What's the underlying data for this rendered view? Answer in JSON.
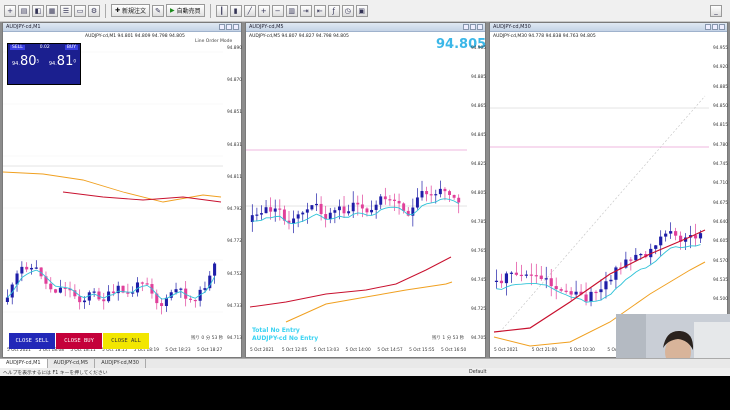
{
  "toolbar": {
    "new_order_label": "新規注文",
    "auto_trade_label": "自動売買"
  },
  "windows": [
    {
      "title": "AUDJPY-cd,M1",
      "symbol_line": "AUDJPY-cd,M1  94.801 94.809 94.798 94.805",
      "corner_text": "Line Order Mode",
      "current_price": "94.805",
      "price_labels": [
        "94.890",
        "94.870",
        "94.851",
        "94.831",
        "94.811",
        "94.792",
        "94.772",
        "94.752",
        "94.733",
        "94.713"
      ],
      "time_labels": [
        "5 Oct 2021",
        "5 Oct 18:08",
        "5 Oct 18:11",
        "5 Oct 18:15",
        "5 Oct 18:19",
        "5 Oct 18:23",
        "5 Oct 18:27"
      ],
      "panel": {
        "sell_label": "SELL",
        "lot_value": "0.02",
        "buy_label": "BUY",
        "sell_price_small": "94.",
        "sell_price_big": "80",
        "sell_price_sup": "5",
        "buy_price_small": "94.",
        "buy_price_big": "81",
        "buy_price_sup": "0"
      },
      "close_buttons": [
        "CLOSE SELL",
        "CLOSE BUY",
        "CLOSE ALL"
      ],
      "note": "残り 0 分 53 秒"
    },
    {
      "title": "AUDJPY-cd,M5",
      "symbol_line": "AUDJPY-cd,M5  94.807 94.827 94.798 94.805",
      "big_price": "94.805",
      "price_labels": [
        "94.905",
        "94.885",
        "94.865",
        "94.845",
        "94.825",
        "94.805",
        "94.785",
        "94.765",
        "94.745",
        "94.725",
        "94.705"
      ],
      "line_labels": [
        "94.838",
        "94.805"
      ],
      "time_labels": [
        "5 Oct 2021",
        "5 Oct 12:05",
        "5 Oct 13:03",
        "5 Oct 14:00",
        "5 Oct 14:57",
        "5 Oct 15:55",
        "5 Oct 16:50"
      ],
      "entry_lines": [
        "Total No Entry",
        "AUDJPY-cd No Entry"
      ],
      "note": "残り 1 分 53 秒"
    },
    {
      "title": "AUDJPY-cd,M30",
      "symbol_line": "AUDJPY-cd,M30  94.778 94.838 94.763 94.805",
      "price_labels": [
        "94.955",
        "94.920",
        "94.885",
        "94.850",
        "94.815",
        "94.780",
        "94.745",
        "94.710",
        "94.675",
        "94.640",
        "94.605",
        "94.570",
        "94.535",
        "94.500",
        "94.465",
        "94.430"
      ],
      "line_labels": [
        "94.805",
        "94.748"
      ],
      "time_labels": [
        "5 Oct 2021",
        "5 Oct 21:00",
        "5 Oct 10:30",
        "5 Oct 21:30",
        "5 Oct 14:30",
        "5 Oct 18:00"
      ]
    }
  ],
  "tabs": [
    "AUDJPY-cd,M1",
    "AUDJPY-cd,M5",
    "AUDJPY-cd,M30"
  ],
  "status": {
    "left": "ヘルプを表示するには F1 キーを押してください",
    "mid": "Default"
  },
  "colors": {
    "bull_candle": "#1e1ea8",
    "bear_candle": "#e0409a",
    "ma_fast": "#2fc3d8",
    "ma_mid": "#c8102e",
    "ma_slow": "#f0a020",
    "sell_panel": "#1b1f8f",
    "close_sell": "#2228b8",
    "close_buy": "#c4003a",
    "close_all": "#f2e600"
  }
}
